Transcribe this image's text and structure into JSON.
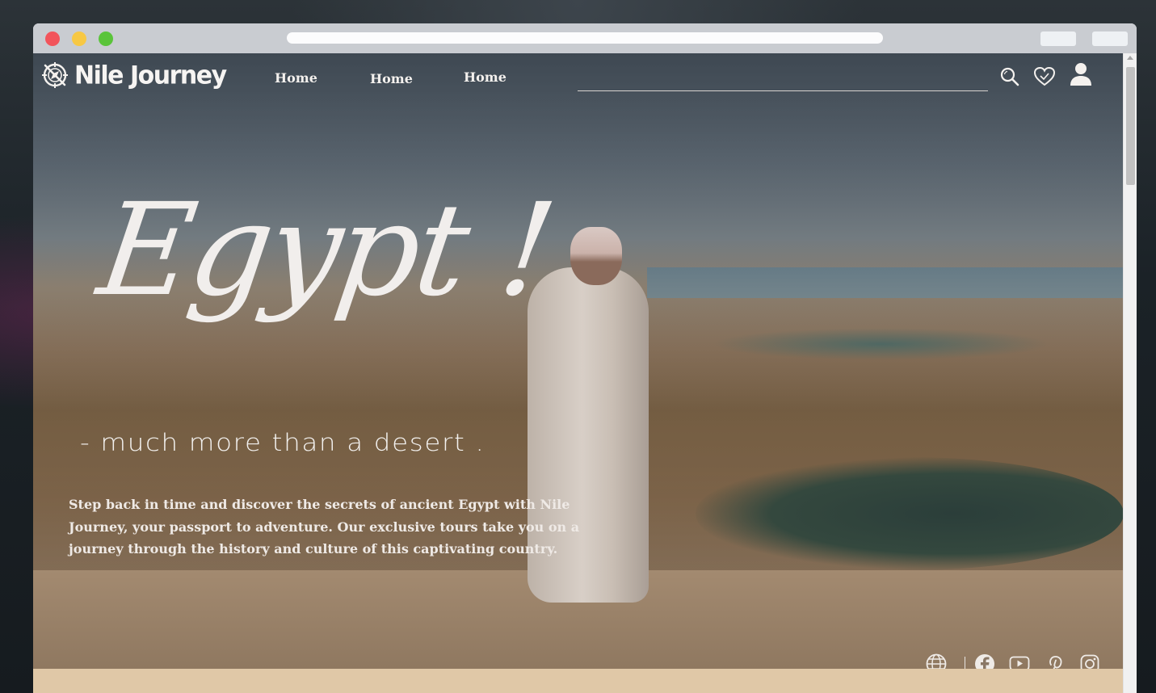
{
  "brand": {
    "name": "Nile Journey",
    "logo_icon": "compass-icon"
  },
  "nav": {
    "links": [
      {
        "label": "Home"
      },
      {
        "label": "Home"
      },
      {
        "label": "Home"
      }
    ],
    "search": {
      "value": "",
      "placeholder": ""
    },
    "icons": [
      "search-icon",
      "heart-icon",
      "user-icon"
    ]
  },
  "hero": {
    "headline": "Egypt !",
    "tagline": "- much more than a desert .",
    "description": "Step back in time and discover the secrets of ancient Egypt with Nile Journey, your passport to adventure. Our exclusive tours take you on a journey through the history and culture of this captivating country."
  },
  "social": {
    "icons": [
      "globe-icon",
      "facebook-icon",
      "youtube-icon",
      "pinterest-icon",
      "instagram-icon"
    ]
  },
  "colors": {
    "accent_band": "#e0c8a7",
    "text_light": "#f4f1ee",
    "titlebar": "#c9ccd1"
  }
}
